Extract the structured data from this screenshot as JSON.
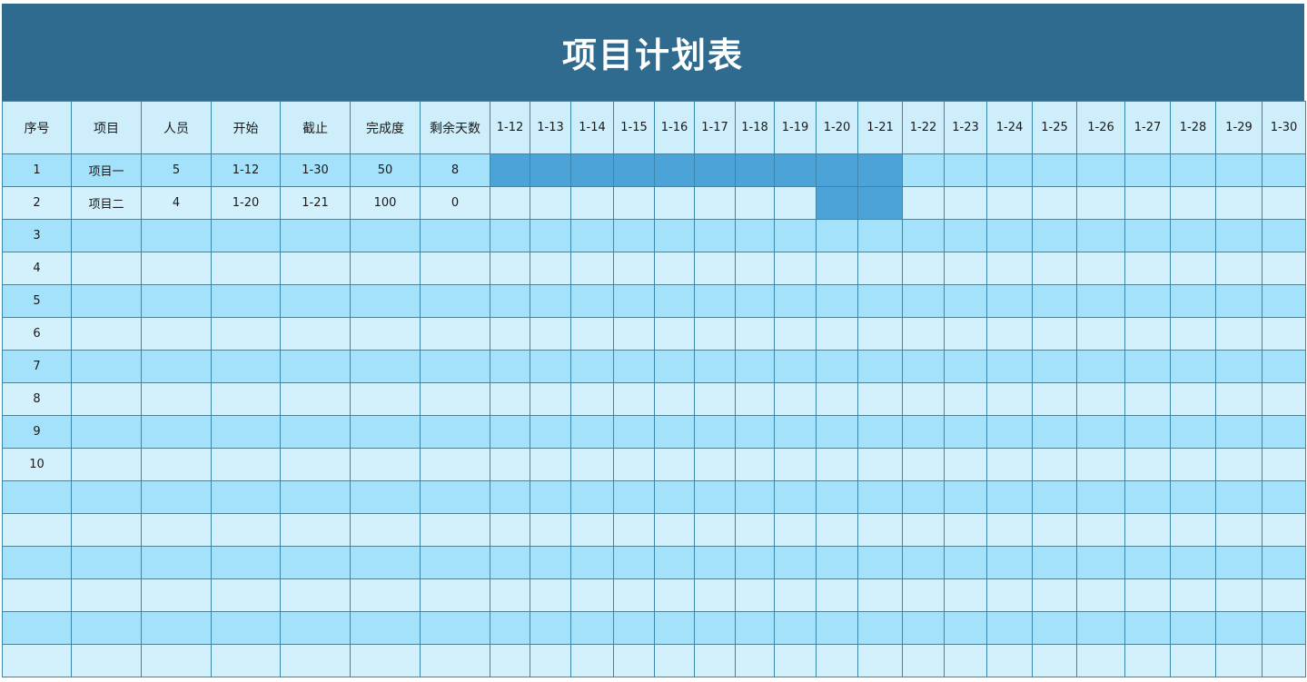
{
  "title": "项目计划表",
  "columns": [
    "序号",
    "项目",
    "人员",
    "开始",
    "截止",
    "完成度",
    "剩余天数"
  ],
  "dates": [
    "1-12",
    "1-13",
    "1-14",
    "1-15",
    "1-16",
    "1-17",
    "1-18",
    "1-19",
    "1-20",
    "1-21",
    "1-22",
    "1-23",
    "1-24",
    "1-25",
    "1-26",
    "1-27",
    "1-28",
    "1-29",
    "1-30"
  ],
  "rows": [
    {
      "no": "1",
      "project": "项目一",
      "people": "5",
      "start": "1-12",
      "end": "1-30",
      "progress": "50",
      "remaining": "8",
      "bar_start": "1-12",
      "bar_end": "1-21"
    },
    {
      "no": "2",
      "project": "项目二",
      "people": "4",
      "start": "1-20",
      "end": "1-21",
      "progress": "100",
      "remaining": "0",
      "bar_start": "1-20",
      "bar_end": "1-21"
    },
    {
      "no": "3",
      "project": "",
      "people": "",
      "start": "",
      "end": "",
      "progress": "",
      "remaining": ""
    },
    {
      "no": "4",
      "project": "",
      "people": "",
      "start": "",
      "end": "",
      "progress": "",
      "remaining": ""
    },
    {
      "no": "5",
      "project": "",
      "people": "",
      "start": "",
      "end": "",
      "progress": "",
      "remaining": ""
    },
    {
      "no": "6",
      "project": "",
      "people": "",
      "start": "",
      "end": "",
      "progress": "",
      "remaining": ""
    },
    {
      "no": "7",
      "project": "",
      "people": "",
      "start": "",
      "end": "",
      "progress": "",
      "remaining": ""
    },
    {
      "no": "8",
      "project": "",
      "people": "",
      "start": "",
      "end": "",
      "progress": "",
      "remaining": ""
    },
    {
      "no": "9",
      "project": "",
      "people": "",
      "start": "",
      "end": "",
      "progress": "",
      "remaining": ""
    },
    {
      "no": "10",
      "project": "",
      "people": "",
      "start": "",
      "end": "",
      "progress": "",
      "remaining": ""
    },
    {
      "no": "",
      "project": "",
      "people": "",
      "start": "",
      "end": "",
      "progress": "",
      "remaining": ""
    },
    {
      "no": "",
      "project": "",
      "people": "",
      "start": "",
      "end": "",
      "progress": "",
      "remaining": ""
    },
    {
      "no": "",
      "project": "",
      "people": "",
      "start": "",
      "end": "",
      "progress": "",
      "remaining": ""
    },
    {
      "no": "",
      "project": "",
      "people": "",
      "start": "",
      "end": "",
      "progress": "",
      "remaining": ""
    },
    {
      "no": "",
      "project": "",
      "people": "",
      "start": "",
      "end": "",
      "progress": "",
      "remaining": ""
    },
    {
      "no": "",
      "project": "",
      "people": "",
      "start": "",
      "end": "",
      "progress": "",
      "remaining": ""
    }
  ],
  "colors": {
    "title_bg": "#2e6b8e",
    "header_bg": "#cdeefa",
    "row_dark": "#a3e2fa",
    "row_light": "#d3f1fc",
    "bar": "#4ba3d8",
    "grid": "#3b87ab"
  }
}
